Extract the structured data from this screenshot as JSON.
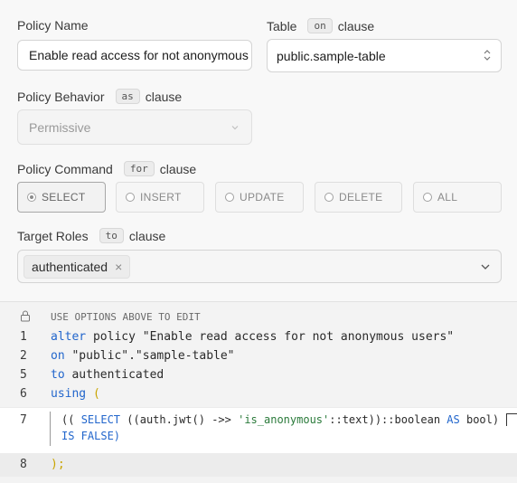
{
  "policy_name": {
    "label": "Policy Name",
    "value": "Enable read access for not anonymous users"
  },
  "table": {
    "label": "Table",
    "kbd": "on",
    "clause": "clause",
    "value": "public.sample-table"
  },
  "behavior": {
    "label": "Policy Behavior",
    "kbd": "as",
    "clause": "clause",
    "value": "Permissive"
  },
  "command": {
    "label": "Policy Command",
    "kbd": "for",
    "clause": "clause",
    "options": [
      "SELECT",
      "INSERT",
      "UPDATE",
      "DELETE",
      "ALL"
    ],
    "selected": "SELECT"
  },
  "roles": {
    "label": "Target Roles",
    "kbd": "to",
    "clause": "clause",
    "chip": "authenticated",
    "chip_remove": "×"
  },
  "editor": {
    "hint": "USE OPTIONS ABOVE TO EDIT",
    "line_numbers": [
      "1",
      "2",
      "5",
      "6",
      "7",
      "8"
    ],
    "l1_kw": "alter",
    "l1_rest": " policy \"Enable read access for not anonymous users\"",
    "l2_kw": "on",
    "l2_rest": " \"public\".\"sample-table\"",
    "l5_kw": "to",
    "l5_rest": " authenticated",
    "l6_kw": "using",
    "l6_paren": " (",
    "l7_a": "(( ",
    "l7_select": "SELECT",
    "l7_b": " ((auth.jwt() ->> ",
    "l7_str": "'is_anonymous'",
    "l7_c": "::text))::boolean ",
    "l7_as": "AS",
    "l7_d": " bool)",
    "l7_line2": "IS FALSE)",
    "l8": ");"
  }
}
